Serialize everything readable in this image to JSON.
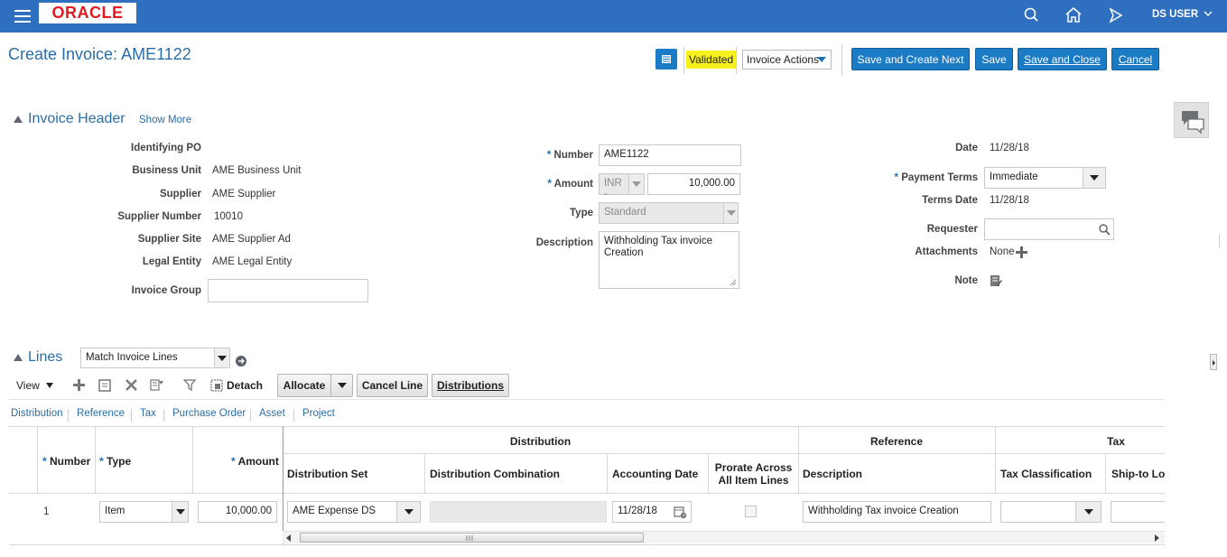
{
  "header": {
    "logo": "ORACLE",
    "user": "DS USER",
    "icons": [
      "menu-icon",
      "search-icon",
      "home-icon",
      "navigator-icon",
      "chevron-down-icon"
    ]
  },
  "page": {
    "title": "Create Invoice: AME1122",
    "status": "Validated",
    "invoice_actions": "Invoice Actions",
    "buttons": {
      "save_create_next": "Save and Create Next",
      "save": "Save",
      "save_close": "Save and Close",
      "cancel": "Cancel"
    }
  },
  "invoice_header": {
    "title": "Invoice Header",
    "show_more": "Show More",
    "left": [
      {
        "label": "Identifying PO",
        "value": ""
      },
      {
        "label": "Business Unit",
        "value": "AME Business Unit"
      },
      {
        "label": "Supplier",
        "value": "AME Supplier"
      },
      {
        "label": "Supplier Number",
        "value": "10010"
      },
      {
        "label": "Supplier Site",
        "value": "AME Supplier Ad"
      },
      {
        "label": "Legal Entity",
        "value": "AME Legal Entity"
      },
      {
        "label": "Invoice Group",
        "value": ""
      }
    ],
    "number_label": "Number",
    "number_value": "AME1122",
    "amount_label": "Amount",
    "currency": "INR -",
    "amount_value": "10,000.00",
    "type_label": "Type",
    "type_value": "Standard",
    "description_label": "Description",
    "description_value": "Withholding Tax invoice Creation",
    "date_label": "Date",
    "date_value": "11/28/18",
    "payment_terms_label": "Payment Terms",
    "payment_terms_value": "Immediate",
    "terms_date_label": "Terms Date",
    "terms_date_value": "11/28/18",
    "requester_label": "Requester",
    "requester_value": "",
    "attachments_label": "Attachments",
    "attachments_value": "None",
    "note_label": "Note"
  },
  "lines": {
    "title": "Lines",
    "match_select": "Match Invoice Lines",
    "view": "View",
    "detach": "Detach",
    "allocate": "Allocate",
    "cancel_line": "Cancel Line",
    "distributions": "Distributions",
    "tabs": [
      "Distribution",
      "Reference",
      "Tax",
      "Purchase Order",
      "Asset",
      "Project"
    ],
    "group_headers": {
      "distribution": "Distribution",
      "reference": "Reference",
      "tax": "Tax"
    },
    "columns": {
      "number": "Number",
      "type": "Type",
      "amount": "Amount",
      "distribution_set": "Distribution Set",
      "distribution_combination": "Distribution Combination",
      "accounting_date": "Accounting Date",
      "prorate_line1": "Prorate Across",
      "prorate_line2": "All Item Lines",
      "description": "Description",
      "tax_classification": "Tax Classification",
      "ship_to": "Ship-to Loc"
    },
    "rows": [
      {
        "number": "1",
        "type": "Item",
        "amount": "10,000.00",
        "distribution_set": "AME Expense DS",
        "distribution_combination": "",
        "accounting_date": "11/28/18",
        "prorate": false,
        "description": "Withholding Tax invoice Creation",
        "tax_classification": "",
        "ship_to": ""
      }
    ]
  }
}
